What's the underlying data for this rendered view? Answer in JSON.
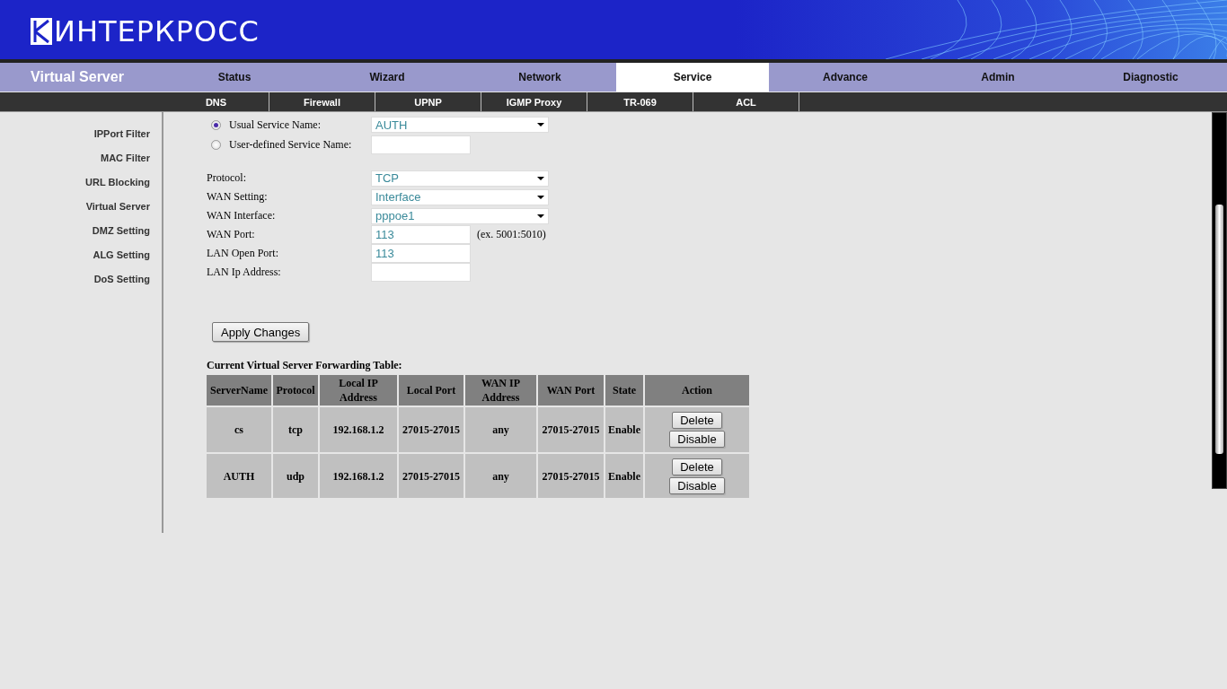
{
  "logo": {
    "text": "ИНТЕРКРОСС"
  },
  "page_title": "Virtual Server",
  "tabs": [
    {
      "label": "Status",
      "selected": false
    },
    {
      "label": "Wizard",
      "selected": false
    },
    {
      "label": "Network",
      "selected": false
    },
    {
      "label": "Service",
      "selected": true
    },
    {
      "label": "Advance",
      "selected": false
    },
    {
      "label": "Admin",
      "selected": false
    },
    {
      "label": "Diagnostic",
      "selected": false
    }
  ],
  "subtabs": [
    "DNS",
    "Firewall",
    "UPNP",
    "IGMP Proxy",
    "TR-069",
    "ACL"
  ],
  "sidebar": {
    "items": [
      "IPPort Filter",
      "MAC Filter",
      "URL Blocking",
      "Virtual Server",
      "DMZ Setting",
      "ALG Setting",
      "DoS Setting"
    ]
  },
  "form": {
    "service_name": [
      {
        "label": "Usual Service Name:",
        "selected": true,
        "kind": "select",
        "value": "AUTH"
      },
      {
        "label": "User-defined Service Name:",
        "selected": false,
        "kind": "text"
      }
    ],
    "fields": [
      {
        "label": "Protocol:",
        "kind": "select",
        "value": "TCP"
      },
      {
        "label": "WAN Setting:",
        "kind": "select",
        "value": "Interface"
      },
      {
        "label": "WAN Interface:",
        "kind": "select",
        "value": "pppoe1"
      },
      {
        "label": "WAN Port:",
        "kind": "text",
        "value": "113",
        "hint": "(ex. 5001:5010)"
      },
      {
        "label": "LAN Open Port:",
        "kind": "text",
        "value": "113"
      },
      {
        "label": "LAN Ip Address:",
        "kind": "text"
      }
    ],
    "apply_button": "Apply Changes"
  },
  "table": {
    "title": "Current Virtual Server Forwarding Table:",
    "columns": [
      "ServerName",
      "Protocol",
      "Local IP Address",
      "Local Port",
      "WAN IP Address",
      "WAN Port",
      "State",
      "Action"
    ],
    "rows": [
      {
        "cells": [
          "cs",
          "tcp",
          "192.168.1.2",
          "27015-27015",
          "any",
          "27015-27015",
          "Enable"
        ],
        "actions": [
          "Delete",
          "Disable"
        ]
      },
      {
        "cells": [
          "AUTH",
          "udp",
          "192.168.1.2",
          "27015-27015",
          "any",
          "27015-27015",
          "Enable"
        ],
        "actions": [
          "Delete",
          "Disable"
        ]
      }
    ]
  }
}
